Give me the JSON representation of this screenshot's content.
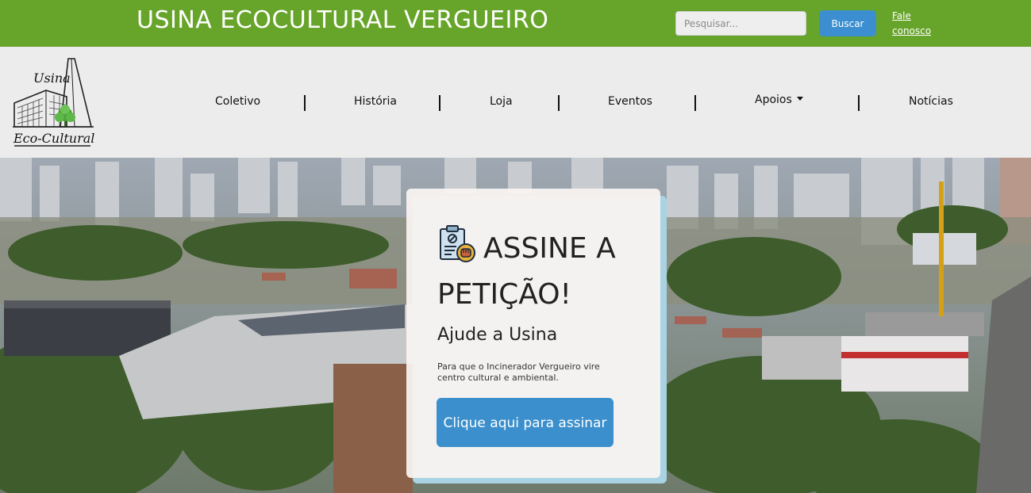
{
  "header": {
    "site_title": "USINA ECOCULTURAL VERGUEIRO",
    "search_placeholder": "Pesquisar...",
    "search_button": "Buscar",
    "contact_link_line1": "Fale",
    "contact_link_line2": "conosco"
  },
  "logo": {
    "line1": "Usina",
    "line2": "Eco-Cultural"
  },
  "nav": {
    "items": [
      {
        "label": "Coletivo"
      },
      {
        "label": "História"
      },
      {
        "label": "Loja"
      },
      {
        "label": "Eventos"
      },
      {
        "label": "Apoios",
        "dropdown": true
      },
      {
        "label": "Notícias"
      }
    ]
  },
  "hero": {
    "icon": "petition-clipboard-fist-icon",
    "heading": "ASSINE A PETIÇÃO!",
    "subtitle": "Ajude a Usina",
    "text": "Para que o Incinerador Vergueiro vire centro cultural e ambiental.",
    "button": "Clique aqui para assinar"
  },
  "colors": {
    "topbar": "#67a42a",
    "button_blue": "#3b8fd0",
    "nav_bg": "#ececec",
    "card_accent": "#a9d3e2"
  }
}
